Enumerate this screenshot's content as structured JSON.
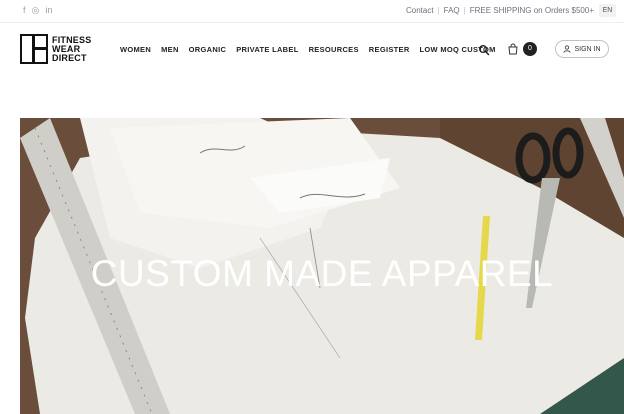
{
  "topbar": {
    "social": [
      "f",
      "◎",
      "in"
    ],
    "links": [
      "Contact",
      "FAQ",
      "FREE SHIPPING on Orders $500+"
    ],
    "language": "EN"
  },
  "header": {
    "logo_lines": [
      "FITNESS",
      "WEAR",
      "DIRECT"
    ],
    "nav": [
      "WOMEN",
      "MEN",
      "ORGANIC",
      "PRIVATE LABEL",
      "RESOURCES",
      "REGISTER",
      "LOW MOQ CUSTOM"
    ],
    "cart_count": "0",
    "signin_label": "SIGN IN"
  },
  "hero": {
    "title": "CUSTOM MADE APPAREL",
    "colors": {
      "table": "#6a4d3a",
      "paper": "#f2f1ee",
      "ruler": "#c9c8c2",
      "pencil": "#e6d84a"
    }
  }
}
